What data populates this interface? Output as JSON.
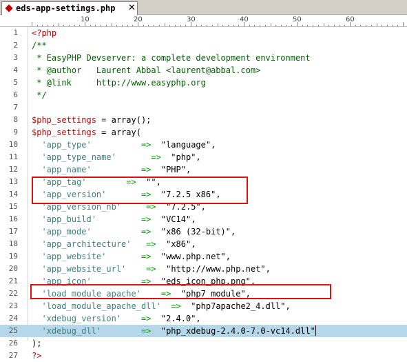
{
  "tab": {
    "title": "eds-app-settings.php",
    "close_glyph": "✕",
    "icon": "diamond-file-icon",
    "icon_color": "#c40000"
  },
  "ruler": {
    "labels": [
      "10",
      "20",
      "30",
      "40",
      "50",
      "60"
    ]
  },
  "colors": {
    "highlight": "#b6d7ea",
    "annotation": "#e01010",
    "comment": "#005f00",
    "key": "#408080",
    "arrow": "#00a000",
    "variable": "#c00000"
  },
  "lines": [
    {
      "n": "1",
      "tokens": [
        {
          "t": "<?php",
          "c": "tag"
        }
      ]
    },
    {
      "n": "2",
      "tokens": [
        {
          "t": "/**",
          "c": "comment"
        }
      ]
    },
    {
      "n": "3",
      "tokens": [
        {
          "t": " * EasyPHP Devserver: a complete development environment",
          "c": "comment"
        }
      ]
    },
    {
      "n": "4",
      "tokens": [
        {
          "t": " * @author   Laurent Abbal <laurent@abbal.com>",
          "c": "comment"
        }
      ]
    },
    {
      "n": "5",
      "tokens": [
        {
          "t": " * @link     http://www.easyphp.org",
          "c": "comment"
        }
      ]
    },
    {
      "n": "6",
      "tokens": [
        {
          "t": " */",
          "c": "comment"
        }
      ]
    },
    {
      "n": "7",
      "tokens": []
    },
    {
      "n": "8",
      "tokens": [
        {
          "t": "$php_settings",
          "c": "var"
        },
        {
          "t": " = ",
          "c": "default"
        },
        {
          "t": "array",
          "c": "kw"
        },
        {
          "t": "();",
          "c": "punct"
        }
      ]
    },
    {
      "n": "9",
      "tokens": [
        {
          "t": "$php_settings",
          "c": "var"
        },
        {
          "t": " = ",
          "c": "default"
        },
        {
          "t": "array",
          "c": "kw"
        },
        {
          "t": "(",
          "c": "punct"
        }
      ]
    },
    {
      "n": "10",
      "tokens": [
        {
          "t": "  'app_type'",
          "c": "key"
        },
        {
          "t": "          =>",
          "c": "arrow"
        },
        {
          "t": "  \"language\",",
          "c": "str"
        }
      ]
    },
    {
      "n": "11",
      "tokens": [
        {
          "t": "  'app_type_name'",
          "c": "key"
        },
        {
          "t": "       =>",
          "c": "arrow"
        },
        {
          "t": "  \"php\",",
          "c": "str"
        }
      ]
    },
    {
      "n": "12",
      "tokens": [
        {
          "t": "  'app_name'",
          "c": "key"
        },
        {
          "t": "          =>",
          "c": "arrow"
        },
        {
          "t": "  \"PHP\",",
          "c": "str"
        }
      ]
    },
    {
      "n": "13",
      "tokens": [
        {
          "t": "  'app_tag'",
          "c": "key"
        },
        {
          "t": "        =>",
          "c": "arrow"
        },
        {
          "t": "  \"\",",
          "c": "str"
        }
      ]
    },
    {
      "n": "14",
      "tokens": [
        {
          "t": "  'app_version'",
          "c": "key"
        },
        {
          "t": "       =>",
          "c": "arrow"
        },
        {
          "t": "  \"7.2.5 x86\",",
          "c": "str"
        }
      ]
    },
    {
      "n": "15",
      "tokens": [
        {
          "t": "  'app_version_nb'",
          "c": "key"
        },
        {
          "t": "     =>",
          "c": "arrow"
        },
        {
          "t": "  \"7.2.5\",",
          "c": "str"
        }
      ]
    },
    {
      "n": "16",
      "tokens": [
        {
          "t": "  'app_build'",
          "c": "key"
        },
        {
          "t": "         =>",
          "c": "arrow"
        },
        {
          "t": "  \"VC14\",",
          "c": "str"
        }
      ]
    },
    {
      "n": "17",
      "tokens": [
        {
          "t": "  'app_mode'",
          "c": "key"
        },
        {
          "t": "          =>",
          "c": "arrow"
        },
        {
          "t": "  \"x86 (32-bit)\",",
          "c": "str"
        }
      ]
    },
    {
      "n": "18",
      "tokens": [
        {
          "t": "  'app_architecture'",
          "c": "key"
        },
        {
          "t": "   =>",
          "c": "arrow"
        },
        {
          "t": "  \"x86\",",
          "c": "str"
        }
      ]
    },
    {
      "n": "19",
      "tokens": [
        {
          "t": "  'app_website'",
          "c": "key"
        },
        {
          "t": "       =>",
          "c": "arrow"
        },
        {
          "t": "  \"www.php.net\",",
          "c": "str"
        }
      ]
    },
    {
      "n": "20",
      "tokens": [
        {
          "t": "  'app_website_url'",
          "c": "key"
        },
        {
          "t": "    =>",
          "c": "arrow"
        },
        {
          "t": "  \"http://www.php.net\",",
          "c": "str"
        }
      ]
    },
    {
      "n": "21",
      "tokens": [
        {
          "t": "  'app_icon'",
          "c": "key"
        },
        {
          "t": "          =>",
          "c": "arrow"
        },
        {
          "t": "  \"eds_icon_php.png\",",
          "c": "str"
        }
      ]
    },
    {
      "n": "22",
      "tokens": [
        {
          "t": "  'load_module_apache'",
          "c": "key"
        },
        {
          "t": "    =>",
          "c": "arrow"
        },
        {
          "t": "  \"php7_module\",",
          "c": "str"
        }
      ]
    },
    {
      "n": "23",
      "tokens": [
        {
          "t": "  'load_module_apache_dll'",
          "c": "key"
        },
        {
          "t": "  =>",
          "c": "arrow"
        },
        {
          "t": "  \"php7apache2_4.dll\",",
          "c": "str"
        }
      ]
    },
    {
      "n": "24",
      "tokens": [
        {
          "t": "  'xdebug_version'",
          "c": "key"
        },
        {
          "t": "    =>",
          "c": "arrow"
        },
        {
          "t": "  \"2.4.0\",",
          "c": "str"
        }
      ]
    },
    {
      "n": "25",
      "tokens": [
        {
          "t": "  'xdebug_dll'",
          "c": "key"
        },
        {
          "t": "        =>",
          "c": "arrow"
        },
        {
          "t": "  \"php_xdebug-2.4.0-7.0-vc14.dll\"",
          "c": "str"
        }
      ]
    },
    {
      "n": "26",
      "tokens": [
        {
          "t": ");",
          "c": "punct"
        }
      ]
    },
    {
      "n": "27",
      "tokens": [
        {
          "t": "?>",
          "c": "tag"
        }
      ]
    }
  ],
  "highlighted_line": "25"
}
